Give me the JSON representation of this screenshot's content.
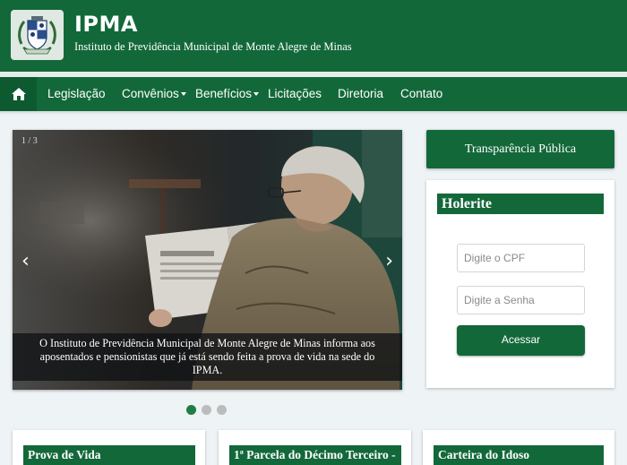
{
  "header": {
    "title": "IPMA",
    "subtitle": "Instituto de Previdência Municipal de Monte Alegre de Minas",
    "logo_icon": "crest-logo-icon"
  },
  "nav": {
    "home_icon": "home-icon",
    "items": [
      {
        "label": "Legislação",
        "dropdown": false
      },
      {
        "label": "Convênios",
        "dropdown": true
      },
      {
        "label": "Benefícios",
        "dropdown": true
      },
      {
        "label": "Licitações",
        "dropdown": false
      },
      {
        "label": "Diretoria",
        "dropdown": false
      },
      {
        "label": "Contato",
        "dropdown": false
      }
    ]
  },
  "carousel": {
    "counter": "1 / 3",
    "prev_icon": "‹",
    "next_icon": "›",
    "caption": "O Instituto de Previdência Municipal de Monte Alegre de Minas informa aos aposentados e pensionistas que já está sendo feita a prova de vida na sede do IPMA.",
    "slide_count": 3,
    "active_slide": 1
  },
  "sidebar": {
    "transparency_button": "Transparência Pública",
    "holerite": {
      "title": "Holerite",
      "cpf_placeholder": "Digite o CPF",
      "password_placeholder": "Digite a Senha",
      "submit_label": "Acessar"
    }
  },
  "cards": [
    {
      "title": "Prova de Vida"
    },
    {
      "title": "1ª Parcela do Décimo Terceiro -"
    },
    {
      "title": "Carteira do Idoso"
    }
  ],
  "colors": {
    "brand_green": "#13683a",
    "background": "#eef3f5"
  }
}
